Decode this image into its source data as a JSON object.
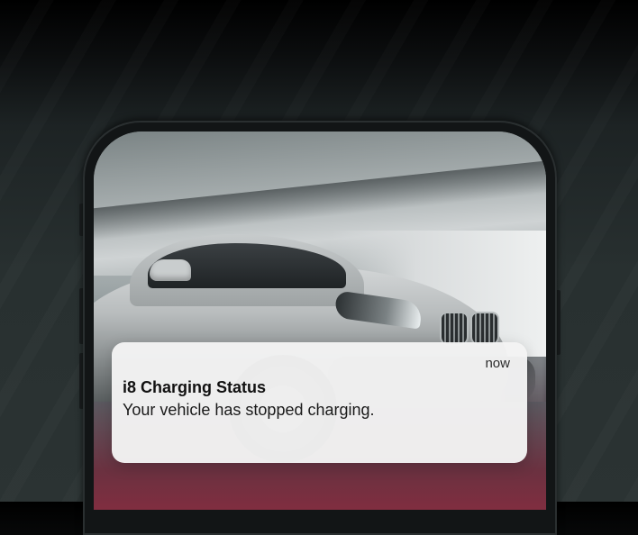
{
  "notification": {
    "time": "now",
    "title": "i8 Charging Status",
    "message": "Your vehicle has stopped charging."
  },
  "wallpaper": {
    "subject": "silver-car-photo"
  },
  "colors": {
    "notification_bg": "#f3f3f3",
    "phone_frame": "#121516",
    "background": "#2b3333"
  }
}
